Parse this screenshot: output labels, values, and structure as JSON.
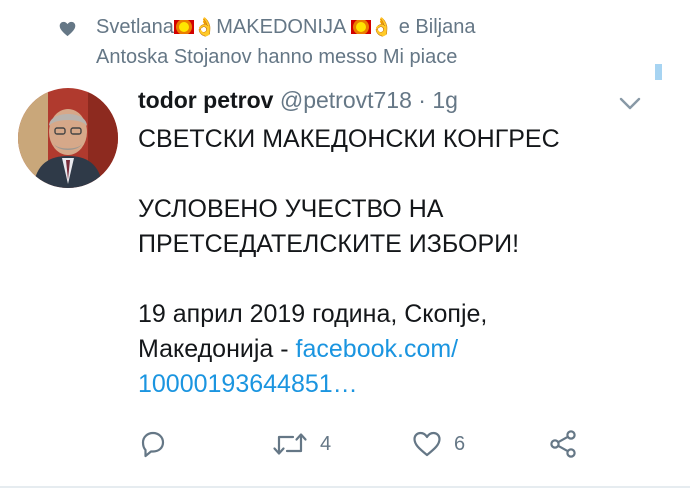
{
  "social_context": {
    "user1_name": "Svetlana",
    "user1_tag": "MAKEDONIJA",
    "conjunction": "e",
    "user2_name": "Biljana",
    "rest": "Antoska Stojanov hanno messo Mi piace"
  },
  "tweet": {
    "author_name": "todor petrov",
    "author_handle": "@petrovt718",
    "separator": "·",
    "time": "1g",
    "body_line1": "СВЕТСКИ МАКЕДОНСКИ КОНГРЕС",
    "body_line2": "УСЛОВЕНО УЧЕСТВО НА",
    "body_line3": "ПРЕТСЕДАТЕЛСКИТЕ ИЗБОРИ!",
    "body_line4": "19 април 2019 година, Скопје,",
    "body_line5_text": "Македонија - ",
    "link_line1": "facebook.com/",
    "link_line2": "10000193644851…"
  },
  "actions": {
    "reply_count": "",
    "retweet_count": "4",
    "like_count": "6"
  },
  "colors": {
    "text_primary": "#14171a",
    "text_secondary": "#657786",
    "link": "#1b95e0",
    "divider": "#e6ecf0"
  },
  "icons": [
    "heart-icon",
    "flag-mk-icon",
    "ok-hand-icon",
    "chevron-down-icon",
    "reply-icon",
    "retweet-icon",
    "like-icon",
    "share-icon"
  ]
}
